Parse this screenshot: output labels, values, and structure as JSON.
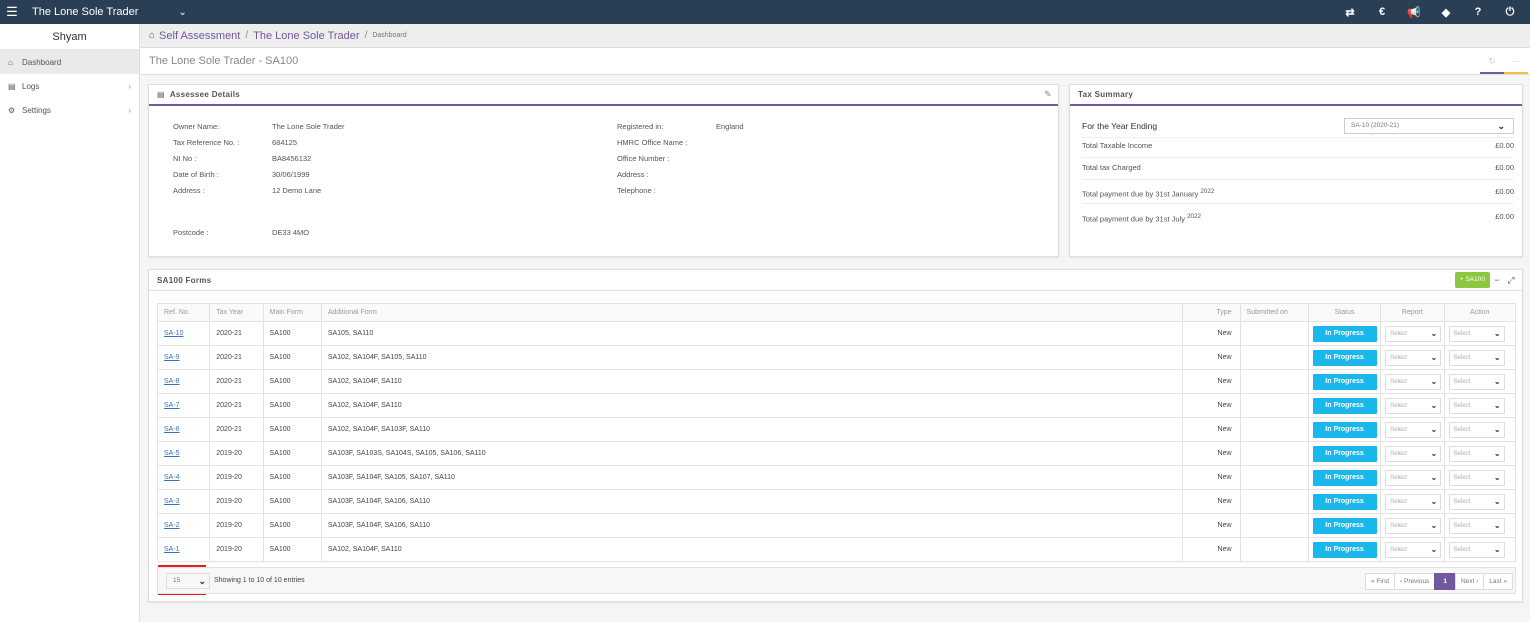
{
  "topbar": {
    "app_title": "The Lone Sole Trader",
    "icons": [
      "menu-icon",
      "chevron-down-icon",
      "swap-icon",
      "currency-icon",
      "megaphone-icon",
      "tag-icon",
      "help-icon",
      "power-icon"
    ]
  },
  "sidebar": {
    "user": "Shyam",
    "items": [
      {
        "label": "Dashboard",
        "icon": "home-icon",
        "active": true
      },
      {
        "label": "Logs",
        "icon": "file-icon"
      },
      {
        "label": "Settings",
        "icon": "gear-icon"
      }
    ]
  },
  "breadcrumb": {
    "first": "Self Assessment",
    "second": "The Lone Sole Trader",
    "sep": "/",
    "current": "Dashboard"
  },
  "page": {
    "title": "The Lone Sole Trader - SA100"
  },
  "assessee": {
    "title": "Assessee Details",
    "owner_label": "Owner Name:",
    "owner": "The Lone Sole Trader",
    "taxref_label": "Tax Reference No. :",
    "taxref": "684125",
    "ni_label": "NI No :",
    "ni": "BA8456132",
    "dob_label": "Date of Birth :",
    "dob": "30/06/1999",
    "address_label": "Address :",
    "address": "12 Demo Lane",
    "postcode_label": "Postcode :",
    "postcode": "DE33 4MO",
    "registered_label": "Registered in:",
    "registered": "England",
    "hmrc_label": "HMRC Office Name :",
    "office_label": "Office Number :",
    "address2_label": "Address :",
    "telephone_label": "Telephone :"
  },
  "tax_summary": {
    "title": "Tax Summary",
    "year_label": "For the Year Ending",
    "year_select": "SA-10 (2020-21)",
    "rows": [
      {
        "label": "Total Taxable Income",
        "value": "£0.00"
      },
      {
        "label": "Total tax Charged",
        "value": "£0.00"
      },
      {
        "label": "Total payment due by 31st January",
        "sup": "2022",
        "value": "£0.00"
      },
      {
        "label": "Total payment due by 31st July",
        "sup": "2022",
        "value": "£0.00"
      }
    ]
  },
  "forms": {
    "title": "SA100 Forms",
    "add_label": "+ SA100",
    "headers": [
      "Ref. No.",
      "Tax Year",
      "Main Form",
      "Additional Form",
      "Type",
      "Submitted on",
      "Status",
      "Report",
      "Action"
    ],
    "select_label": "Select",
    "rows": [
      {
        "ref": "SA-10",
        "year": "2020-21",
        "main": "SA100",
        "additional": "SA105, SA110",
        "type": "New",
        "submitted": "",
        "status": "In Progress"
      },
      {
        "ref": "SA-9",
        "year": "2020-21",
        "main": "SA100",
        "additional": "SA102, SA104F, SA105, SA110",
        "type": "New",
        "submitted": "",
        "status": "In Progress"
      },
      {
        "ref": "SA-8",
        "year": "2020-21",
        "main": "SA100",
        "additional": "SA102, SA104F, SA110",
        "type": "New",
        "submitted": "",
        "status": "In Progress"
      },
      {
        "ref": "SA-7",
        "year": "2020-21",
        "main": "SA100",
        "additional": "SA102, SA104F, SA110",
        "type": "New",
        "submitted": "",
        "status": "In Progress"
      },
      {
        "ref": "SA-6",
        "year": "2020-21",
        "main": "SA100",
        "additional": "SA102, SA104F, SA103F, SA110",
        "type": "New",
        "submitted": "",
        "status": "In Progress"
      },
      {
        "ref": "SA-5",
        "year": "2019-20",
        "main": "SA100",
        "additional": "SA103F, SA103S, SA104S, SA105, SA106, SA110",
        "type": "New",
        "submitted": "",
        "status": "In Progress"
      },
      {
        "ref": "SA-4",
        "year": "2019-20",
        "main": "SA100",
        "additional": "SA103F, SA104F, SA105, SA107, SA110",
        "type": "New",
        "submitted": "",
        "status": "In Progress"
      },
      {
        "ref": "SA-3",
        "year": "2019-20",
        "main": "SA100",
        "additional": "SA103F, SA104F, SA106, SA110",
        "type": "New",
        "submitted": "",
        "status": "In Progress"
      },
      {
        "ref": "SA-2",
        "year": "2019-20",
        "main": "SA100",
        "additional": "SA103F, SA104F, SA106, SA110",
        "type": "New",
        "submitted": "",
        "status": "In Progress"
      },
      {
        "ref": "SA-1",
        "year": "2019-20",
        "main": "SA100",
        "additional": "SA102, SA104F, SA110",
        "type": "New",
        "submitted": "",
        "status": "In Progress"
      }
    ],
    "page_size": "15",
    "info": "Showing 1 to 10 of 10 entries",
    "pager": {
      "first": "« First",
      "prev": "‹ Previous",
      "current": "1",
      "next": "Next ›",
      "last": "Last »"
    }
  },
  "colors": {
    "topbar": "#2a3f54",
    "accent": "#73589e",
    "status": "#1ab7ea",
    "add": "#8dc63f",
    "highlight": "#e02020"
  }
}
